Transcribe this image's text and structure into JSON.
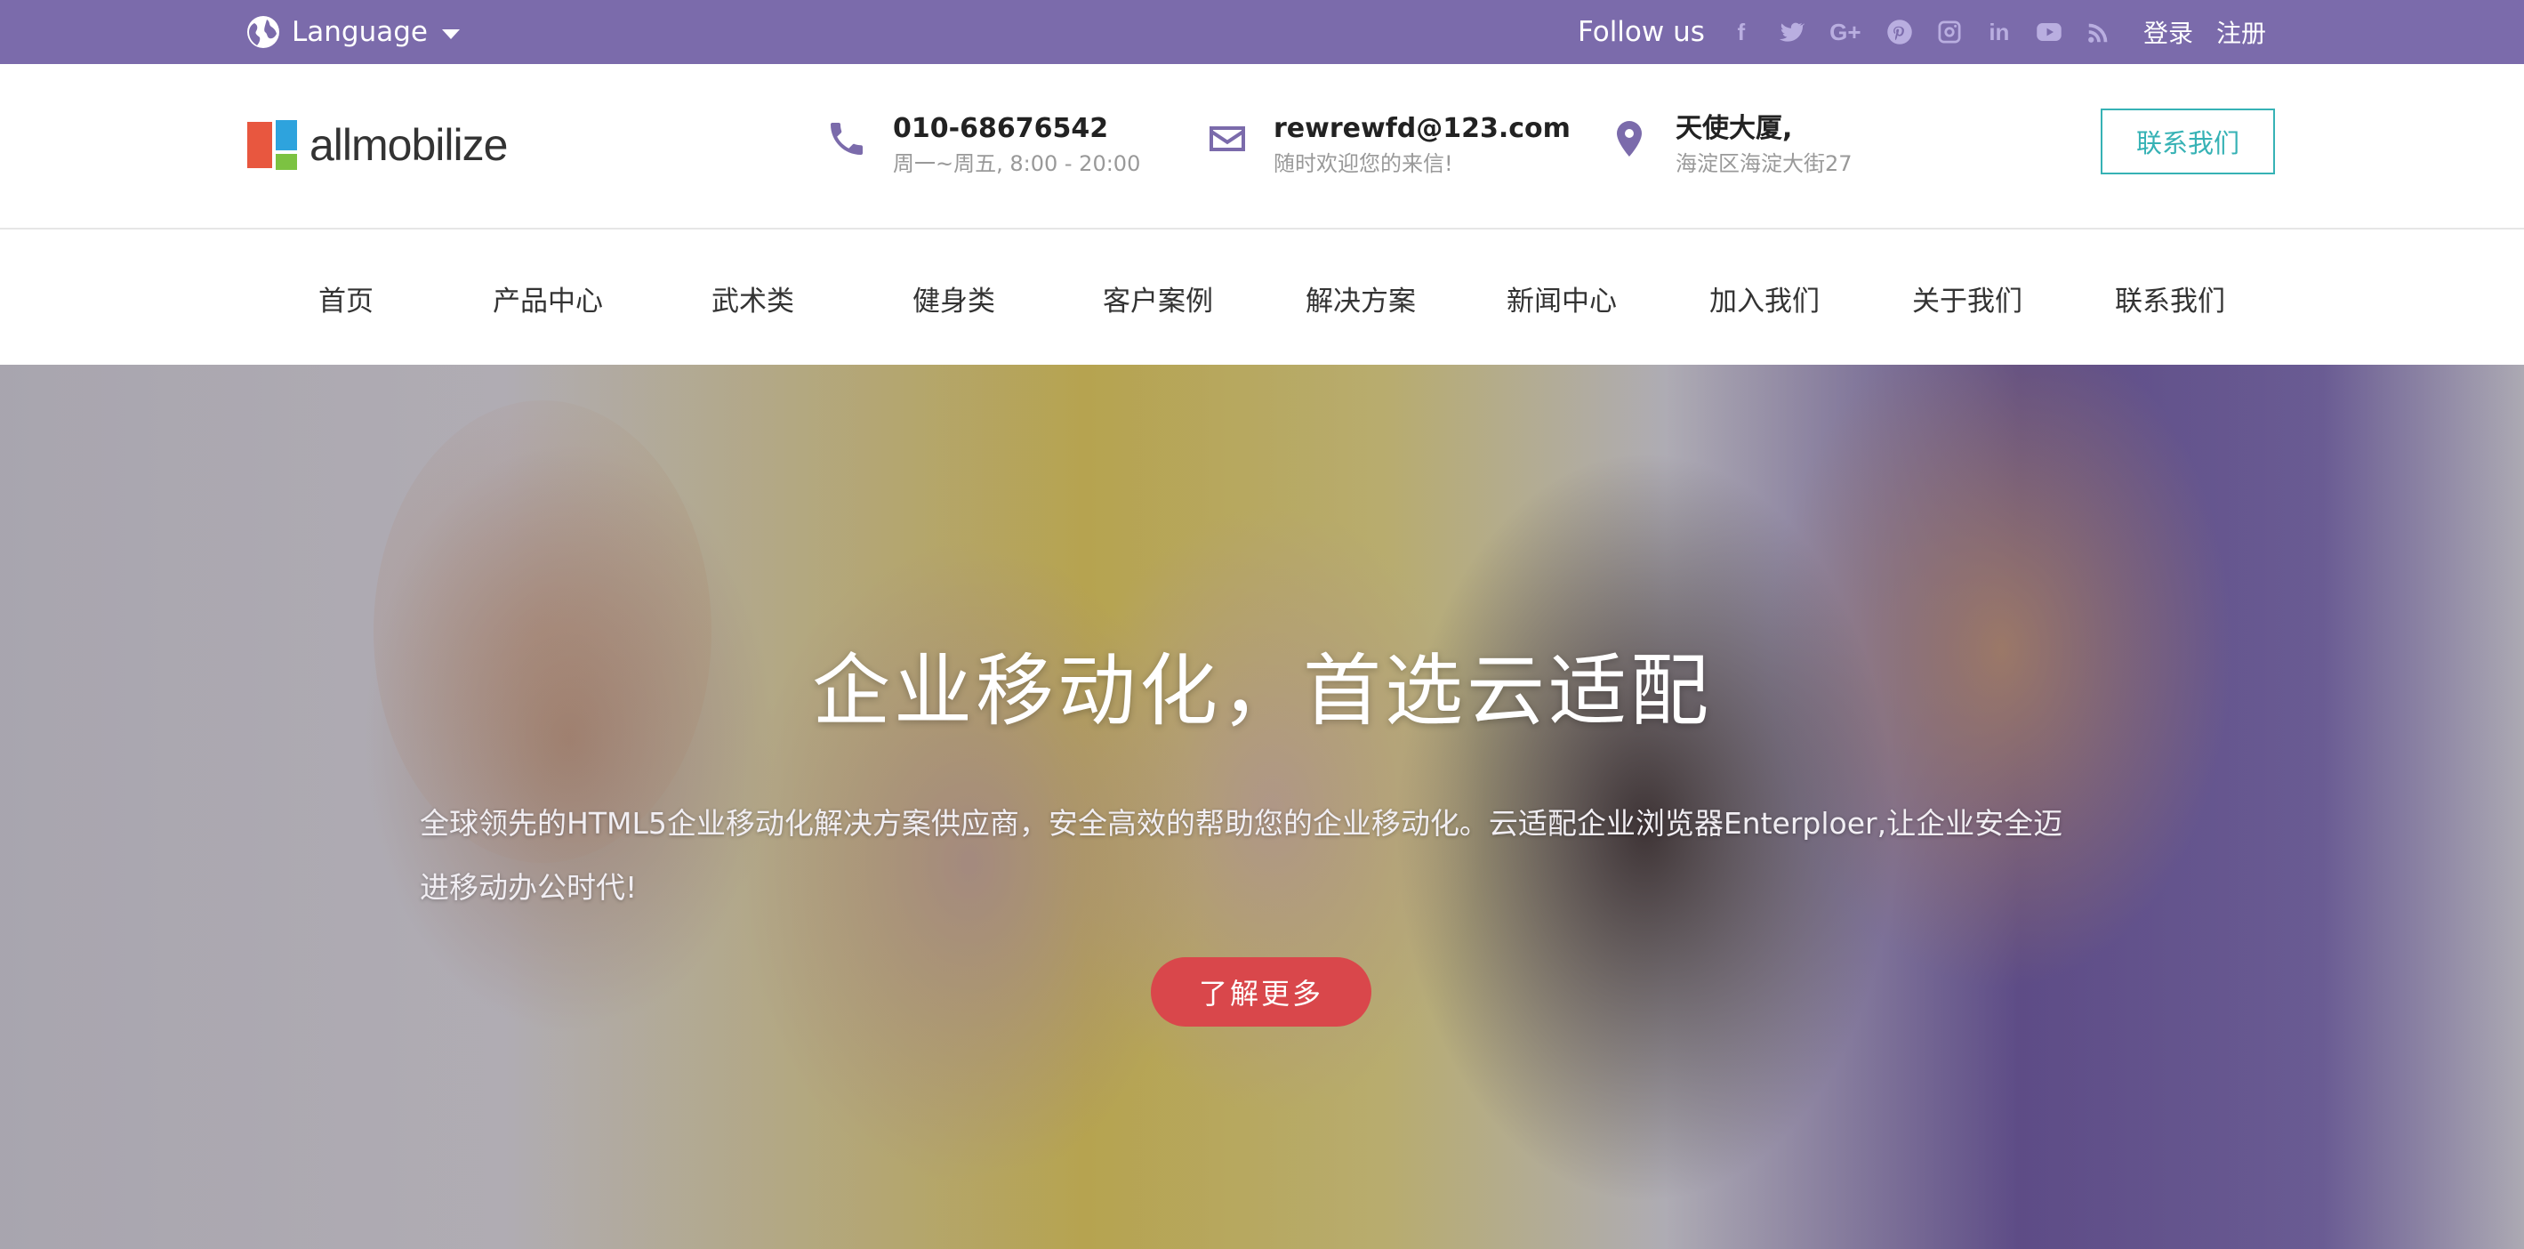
{
  "topbar": {
    "language_label": "Language",
    "follow_label": "Follow us",
    "social_icons": [
      "facebook-icon",
      "twitter-icon",
      "google-plus-icon",
      "pinterest-icon",
      "instagram-icon",
      "linkedin-icon",
      "youtube-icon",
      "rss-icon"
    ],
    "login": "登录",
    "register": "注册",
    "bar_color": "#7b6bab"
  },
  "header": {
    "logo_text": "allmobilize",
    "phone": {
      "main": "010-68676542",
      "sub": "周一~周五, 8:00 - 20:00"
    },
    "email": {
      "main": "rewrewfd@123.com",
      "sub": "随时欢迎您的来信!"
    },
    "address": {
      "main": "天使大厦,",
      "sub": "海淀区海淀大街27"
    },
    "contact_button": "联系我们",
    "accent_color": "#36b2b5"
  },
  "nav": {
    "items": [
      "首页",
      "产品中心",
      "武术类",
      "健身类",
      "客户案例",
      "解决方案",
      "新闻中心",
      "加入我们",
      "关于我们",
      "联系我们"
    ]
  },
  "hero": {
    "title": "企业移动化，首选云适配",
    "description": "全球领先的HTML5企业移动化解决方案供应商，安全高效的帮助您的企业移动化。云适配企业浏览器Enterploer,让企业安全迈进移动办公时代!",
    "button": "了解更多",
    "button_color": "#d9474b"
  }
}
